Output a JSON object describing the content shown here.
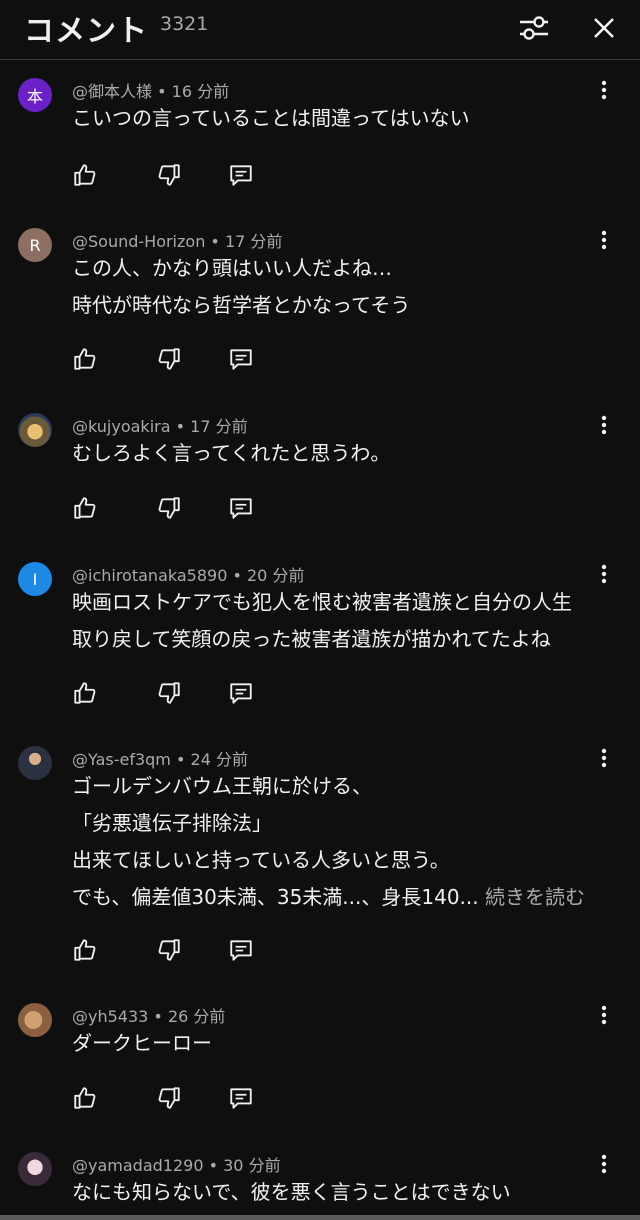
{
  "header": {
    "title": "コメント",
    "count": "3321"
  },
  "comments": [
    {
      "author": "@御本人様",
      "time": "16 分前",
      "avatar_letter": "本",
      "avatar_color": "#6b21c8",
      "lines": [
        "こいつの言っていることは間違ってはいない"
      ]
    },
    {
      "author": "@Sound-Horizon",
      "time": "17 分前",
      "avatar_letter": "R",
      "avatar_color": "#8d6e63",
      "lines": [
        "この人、かなり頭はいい人だよね…",
        "時代が時代なら哲学者とかなってそう"
      ]
    },
    {
      "author": "@kujyoakira",
      "time": "17 分前",
      "avatar_letter": "",
      "avatar_color": "#7a6a4a",
      "lines": [
        "むしろよく言ってくれたと思うわ。"
      ]
    },
    {
      "author": "@ichirotanaka5890",
      "time": "20 分前",
      "avatar_letter": "I",
      "avatar_color": "#1e88e5",
      "lines": [
        "映画ロストケアでも犯人を恨む被害者遺族と自分の人生",
        "取り戻して笑顔の戻った被害者遺族が描かれてたよね"
      ]
    },
    {
      "author": "@Yas-ef3qm",
      "time": "24 分前",
      "avatar_letter": "",
      "avatar_color": "#3d4a5c",
      "lines": [
        "ゴールデンバウム王朝に於ける、",
        "「劣悪遺伝子排除法」",
        "出来てほしいと持っている人多いと思う。",
        "でも、偏差値30未満、35未満...、身長140..."
      ],
      "read_more": "続きを読む"
    },
    {
      "author": "@yh5433",
      "time": "26 分前",
      "avatar_letter": "",
      "avatar_color": "#a07850",
      "lines": [
        "ダークヒーロー"
      ]
    },
    {
      "author": "@yamadad1290",
      "time": "30 分前",
      "avatar_letter": "",
      "avatar_color": "#d8c0d0",
      "lines": [
        "なにも知らないで、彼を悪く言うことはできない"
      ]
    }
  ],
  "icons": {
    "like": "thumbs-up-icon",
    "dislike": "thumbs-down-icon",
    "reply": "reply-icon",
    "menu": "more-vert-icon",
    "filter": "sliders-icon",
    "close": "close-icon"
  }
}
